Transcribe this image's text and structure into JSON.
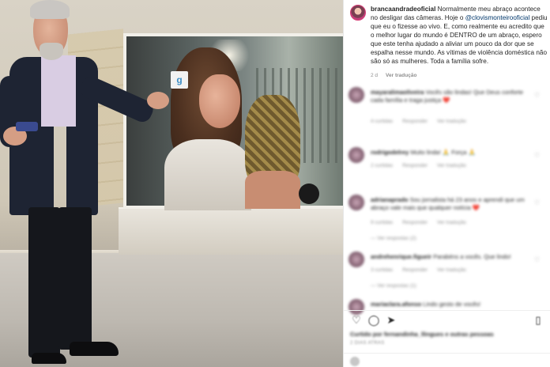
{
  "post": {
    "username": "brancaandradeoficial",
    "caption_part1": " Normalmente meu abraço acontece no desligar das câmeras. Hoje o ",
    "mention": "@clovismonteirooficial",
    "caption_part2": " pediu que eu o fizesse ao vivo. E, como realmente eu acredito que o melhor lugar do mundo é DENTRO de um abraço, espero que este tenha ajudado a aliviar um pouco da dor que se espalha nesse mundo. As vítimas de violência doméstica não são só as mulheres. Toda a família sofre.",
    "age": "2 d",
    "translate_label": "Ver tradução"
  },
  "comments": [
    {
      "user": "mayaralimaoliveira",
      "text": "Vocês são lindas! Que Deus conforte cada família e traga justiça ❤️",
      "meta": [
        "4 curtidas",
        "Responder",
        "Ver tradução"
      ],
      "replies": ""
    },
    {
      "user": "rodrigodelrey",
      "text": "Muito linda! 🙏 Força 🙏",
      "meta": [
        "2 curtidas",
        "Responder",
        "Ver tradução"
      ],
      "replies": ""
    },
    {
      "user": "adrianaprado",
      "text": "Sou jornalista há 23 anos e aprendi que um abraço vale mais que qualquer notícia ❤️",
      "meta": [
        "9 curtidas",
        "Responder",
        "Ver tradução"
      ],
      "replies": "— Ver respostas (2)"
    },
    {
      "user": "andrehenrique.figueir",
      "text": "Parabéns a vocês. Que lindo!",
      "meta": [
        "3 curtidas",
        "Responder",
        "Ver tradução"
      ],
      "replies": "— Ver respostas (1)"
    },
    {
      "user": "mariaclara.afonso",
      "text": "Lindo gesto de vocês!",
      "meta": [],
      "replies": ""
    }
  ],
  "footer": {
    "likes": "Curtido por fernandinha_llingues e outras pessoas",
    "time": "2 DIAS ATRÁS"
  },
  "studio": {
    "screen_logo": "g"
  }
}
